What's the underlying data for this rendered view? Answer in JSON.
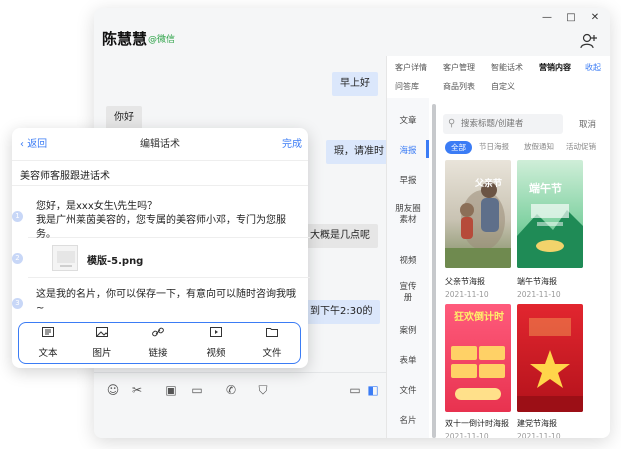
{
  "header": {
    "contact_name": "陈慧慧",
    "contact_tag": "@微信"
  },
  "chat": {
    "messages": [
      {
        "text": "早上好",
        "dir": "out"
      },
      {
        "text": "你好",
        "dir": "in"
      },
      {
        "text": "瑕，请准时",
        "dir": "out"
      },
      {
        "text": "大概是几点呢",
        "dir": "in"
      },
      {
        "text": "到下午2:30的",
        "dir": "out"
      }
    ]
  },
  "panel": {
    "tabs": [
      "客户详情",
      "客户管理",
      "智能话术",
      "营销内容",
      "收起",
      "问答库",
      "商品列表",
      "自定义"
    ],
    "active_tab": "营销内容",
    "sidebar": [
      "文章",
      "海报",
      "早报",
      "朋友圈素材",
      "视频",
      "宣传册",
      "案例",
      "表单",
      "文件",
      "名片"
    ],
    "active_side": "海报",
    "search_placeholder": "搜索标题/创建者",
    "cancel_label": "取消",
    "chips": [
      "全部",
      "节日海报",
      "放假通知",
      "活动促销"
    ],
    "posters": [
      {
        "title": "父亲节海报",
        "date": "2021-11-10",
        "art_text": "父亲节"
      },
      {
        "title": "端午节海报",
        "date": "2021-11-10",
        "art_text": "端午节"
      },
      {
        "title": "双十一倒计时海报",
        "date": "2021-11-10",
        "art_text": "狂欢倒计时"
      },
      {
        "title": "建党节海报",
        "date": "2021-11-10",
        "art_text": ""
      }
    ]
  },
  "edit": {
    "back_label": "返回",
    "title": "编辑话术",
    "done_label": "完成",
    "script_name": "美容师客服跟进话术",
    "items": [
      {
        "num": "1",
        "text": "您好，是xxx女生\\先生吗？\n我是广州莱茵美容的，您专属的美容师小邓，专门为您服务。"
      },
      {
        "num": "2",
        "text": "模版-5.png"
      },
      {
        "num": "3",
        "text": "这是我的名片，你可以保存一下，有意向可以随时咨询我哦~"
      }
    ],
    "actions": [
      "文本",
      "图片",
      "链接",
      "视频",
      "文件"
    ]
  },
  "colors": {
    "accent": "#3b7cf5",
    "wechat_green": "#2ba246"
  }
}
